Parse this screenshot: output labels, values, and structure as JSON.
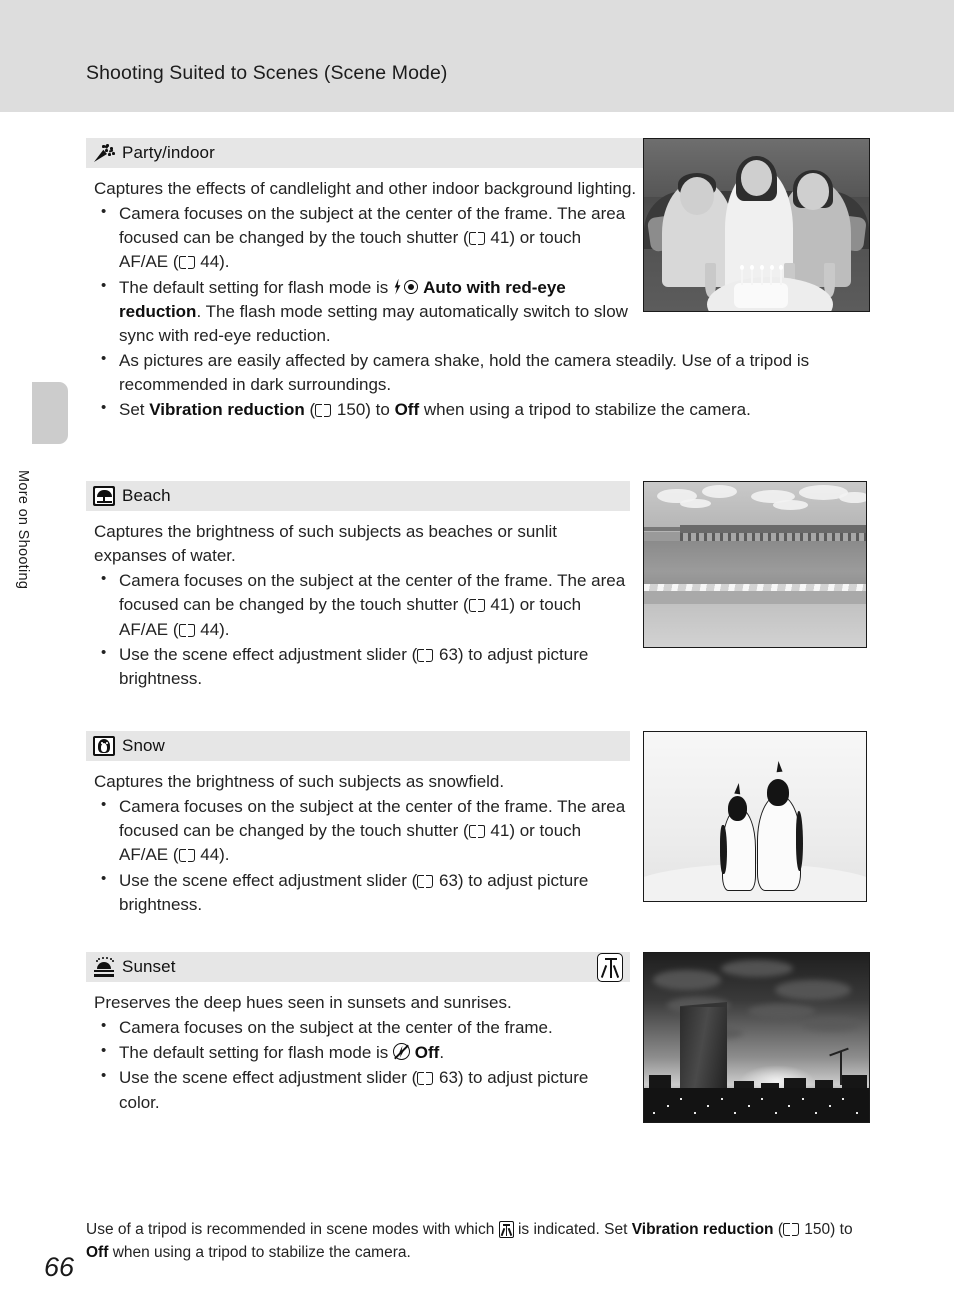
{
  "header": {
    "running_title": "Shooting Suited to Scenes (Scene Mode)"
  },
  "side_tab": {
    "label": "More on Shooting"
  },
  "sections": [
    {
      "icon": "party-popper-icon",
      "title": "Party/indoor",
      "lede": "Captures the effects of candlelight and other indoor background lighting.",
      "bullets": [
        {
          "parts": [
            {
              "t": "text",
              "v": "Camera focuses on the subject at the center of the frame. The area focused can be changed by the touch shutter ("
            },
            {
              "t": "book-icon"
            },
            {
              "t": "text",
              "v": " 41) or touch AF/AE ("
            },
            {
              "t": "book-icon"
            },
            {
              "t": "text",
              "v": " 44)."
            }
          ]
        },
        {
          "parts": [
            {
              "t": "text",
              "v": "The default setting for flash mode is "
            },
            {
              "t": "flash-redeye-icon"
            },
            {
              "t": "bold",
              "v": " Auto with red-eye reduction"
            },
            {
              "t": "text",
              "v": ". The flash mode setting may automatically switch to slow sync with red-eye reduction."
            }
          ]
        },
        {
          "parts": [
            {
              "t": "text",
              "v": "As pictures are easily affected by camera shake, hold the camera steadily. Use of a tripod is recommended in dark surroundings."
            }
          ]
        },
        {
          "parts": [
            {
              "t": "text",
              "v": "Set "
            },
            {
              "t": "bold",
              "v": "Vibration reduction"
            },
            {
              "t": "text",
              "v": " ("
            },
            {
              "t": "book-icon"
            },
            {
              "t": "text",
              "v": " 150) to "
            },
            {
              "t": "bold",
              "v": "Off"
            },
            {
              "t": "text",
              "v": " when using a tripod to stabilize the camera."
            }
          ]
        }
      ],
      "tripod_badge": false,
      "photo": "party-photo",
      "photo_alt": "Three people seated indoors behind a lit birthday cake"
    },
    {
      "icon": "beach-parasol-icon",
      "title": "Beach",
      "lede": "Captures the brightness of such subjects as beaches or sunlit expanses of water.",
      "bullets": [
        {
          "parts": [
            {
              "t": "text",
              "v": "Camera focuses on the subject at the center of the frame. The area focused can be changed by the touch shutter ("
            },
            {
              "t": "book-icon"
            },
            {
              "t": "text",
              "v": " 41) or touch AF/AE ("
            },
            {
              "t": "book-icon"
            },
            {
              "t": "text",
              "v": " 44)."
            }
          ]
        },
        {
          "parts": [
            {
              "t": "text",
              "v": "Use the scene effect adjustment slider ("
            },
            {
              "t": "book-icon"
            },
            {
              "t": "text",
              "v": " 63) to adjust picture brightness."
            }
          ]
        }
      ],
      "tripod_badge": false,
      "photo": "beach-photo",
      "photo_alt": "Sunlit beach with a long pier over the sea"
    },
    {
      "icon": "snow-penguin-icon",
      "title": "Snow",
      "lede": "Captures the brightness of such subjects as snowfield.",
      "bullets": [
        {
          "parts": [
            {
              "t": "text",
              "v": "Camera focuses on the subject at the center of the frame. The area focused can be changed by the touch shutter ("
            },
            {
              "t": "book-icon"
            },
            {
              "t": "text",
              "v": " 41) or touch AF/AE ("
            },
            {
              "t": "book-icon"
            },
            {
              "t": "text",
              "v": " 44)."
            }
          ]
        },
        {
          "parts": [
            {
              "t": "text",
              "v": "Use the scene effect adjustment slider ("
            },
            {
              "t": "book-icon"
            },
            {
              "t": "text",
              "v": " 63) to adjust picture brightness."
            }
          ]
        }
      ],
      "tripod_badge": false,
      "photo": "snow-photo",
      "photo_alt": "Two penguins standing in a bright snowfield"
    },
    {
      "icon": "sunset-icon",
      "title": "Sunset",
      "lede": "Preserves the deep hues seen in sunsets and sunrises.",
      "bullets": [
        {
          "parts": [
            {
              "t": "text",
              "v": "Camera focuses on the subject at the center of the frame."
            }
          ]
        },
        {
          "parts": [
            {
              "t": "text",
              "v": "The default setting for flash mode is "
            },
            {
              "t": "flash-off-icon"
            },
            {
              "t": "bold",
              "v": " Off"
            },
            {
              "t": "text",
              "v": "."
            }
          ]
        },
        {
          "parts": [
            {
              "t": "text",
              "v": "Use the scene effect adjustment slider ("
            },
            {
              "t": "book-icon"
            },
            {
              "t": "text",
              "v": " 63) to adjust picture color."
            }
          ]
        }
      ],
      "tripod_badge": true,
      "photo": "sunset-photo",
      "photo_alt": "City skyline silhouetted against a sunset sky"
    }
  ],
  "footnote": {
    "parts": [
      {
        "t": "text",
        "v": "Use of a tripod is recommended in scene modes with which "
      },
      {
        "t": "tripod-inline-icon"
      },
      {
        "t": "text",
        "v": " is indicated. Set "
      },
      {
        "t": "bold",
        "v": "Vibration reduction"
      },
      {
        "t": "text",
        "v": " ("
      },
      {
        "t": "book-icon"
      },
      {
        "t": "text",
        "v": " 150) to "
      },
      {
        "t": "bold",
        "v": "Off"
      },
      {
        "t": "text",
        "v": " when using a tripod to stabilize the camera."
      }
    ]
  },
  "page_number": "66",
  "colors": {
    "header_band": "#dddddd",
    "section_header": "#e6e6e6",
    "side_tab": "#cccccc",
    "text": "#232323"
  }
}
